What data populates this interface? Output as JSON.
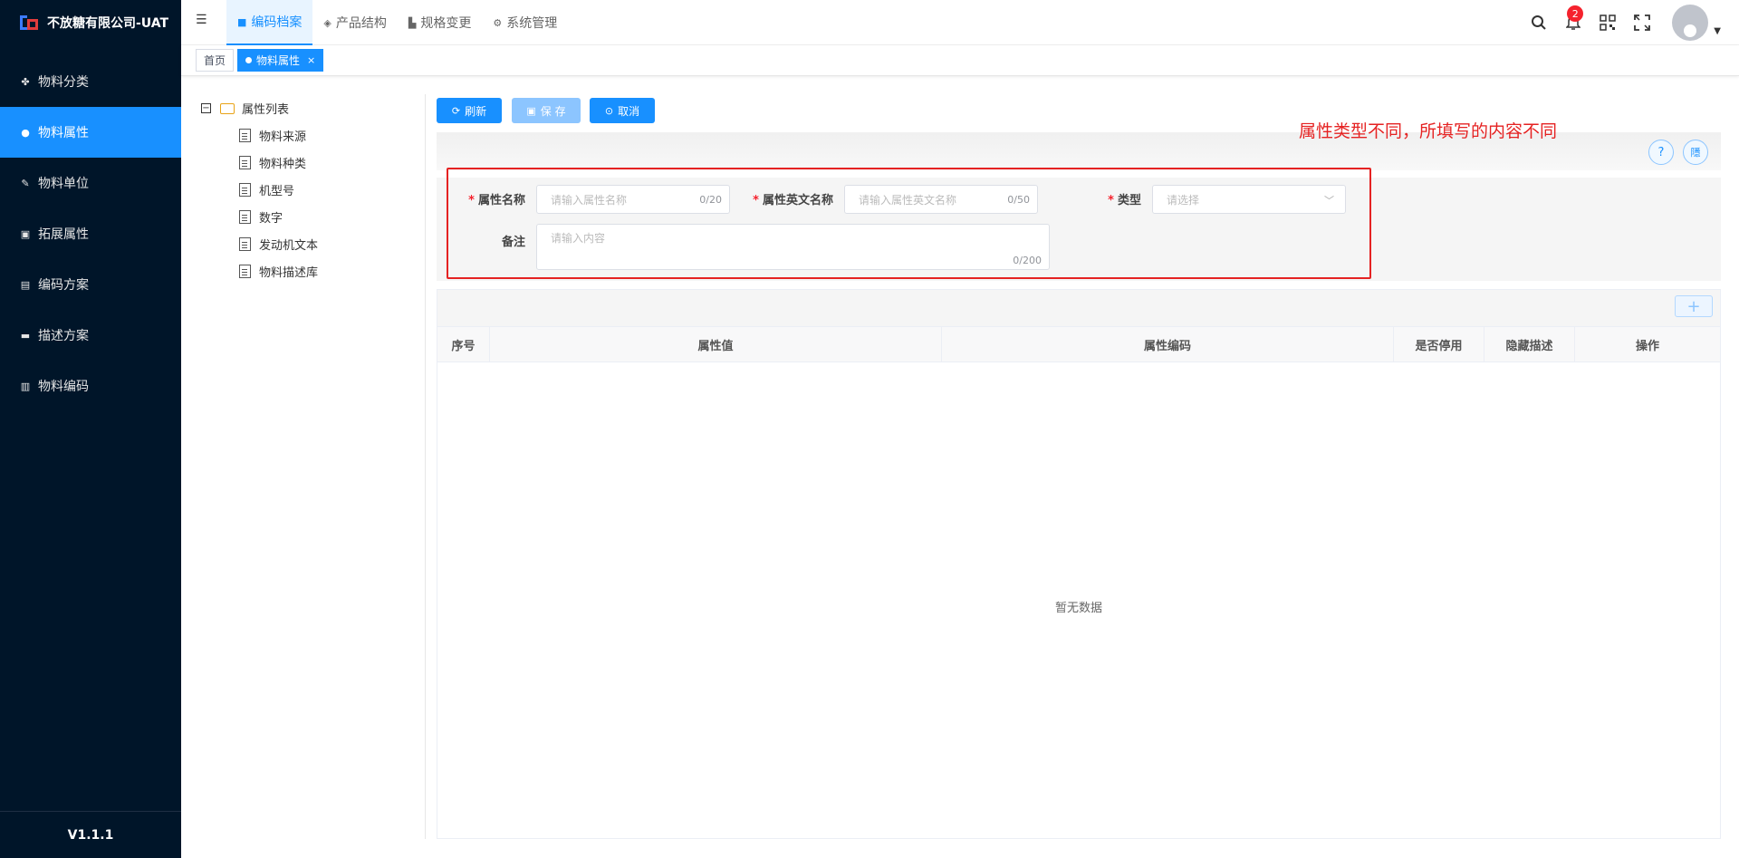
{
  "app": {
    "company": "不放糖有限公司-UAT",
    "version": "V1.1.1"
  },
  "sidebar": {
    "items": [
      {
        "label": "物料分类",
        "icon": "grid-icon"
      },
      {
        "label": "物料属性",
        "icon": "info-icon",
        "active": true
      },
      {
        "label": "物料单位",
        "icon": "ruler-icon"
      },
      {
        "label": "拓展属性",
        "icon": "image-icon"
      },
      {
        "label": "编码方案",
        "icon": "copy-icon"
      },
      {
        "label": "描述方案",
        "icon": "monitor-icon"
      },
      {
        "label": "物料编码",
        "icon": "file-icon"
      }
    ]
  },
  "header": {
    "nav": [
      {
        "label": "编码档案",
        "icon": "folder-icon",
        "active": true
      },
      {
        "label": "产品结构",
        "icon": "layers-icon"
      },
      {
        "label": "规格变更",
        "icon": "chart-icon"
      },
      {
        "label": "系统管理",
        "icon": "gear-icon"
      }
    ],
    "notification_count": "2"
  },
  "tags": {
    "home": "首页",
    "current": "物料属性",
    "close": "×"
  },
  "tree": {
    "root": "属性列表",
    "items": [
      "物料来源",
      "物料种类",
      "机型号",
      "数字",
      "发动机文本",
      "物料描述库"
    ]
  },
  "toolbar": {
    "refresh": "刷新",
    "save": "保 存",
    "cancel": "取消",
    "help": "?",
    "hide": "隱"
  },
  "annotation": "属性类型不同，所填写的内容不同",
  "form": {
    "required_mark": "*",
    "name_label": "属性名称",
    "name_placeholder": "请输入属性名称",
    "name_count": "0/20",
    "en_label": "属性英文名称",
    "en_placeholder": "请输入属性英文名称",
    "en_count": "0/50",
    "type_label": "类型",
    "type_placeholder": "请选择",
    "remark_label": "备注",
    "remark_placeholder": "请输入内容",
    "remark_count": "0/200"
  },
  "table": {
    "add": "+",
    "columns": [
      "序号",
      "属性值",
      "属性编码",
      "是否停用",
      "隐藏描述",
      "操作"
    ],
    "empty_text": "暂无数据"
  },
  "colors": {
    "sidebar_bg": "#001529",
    "primary": "#1890ff",
    "annotation_red": "#e52222"
  }
}
